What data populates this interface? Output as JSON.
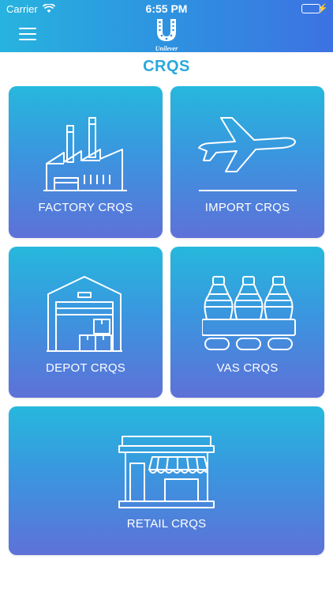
{
  "status_bar": {
    "carrier": "Carrier",
    "time": "6:55 PM"
  },
  "header": {
    "brand": "Unilever"
  },
  "page": {
    "title": "CRQS"
  },
  "tiles": [
    {
      "label": "FACTORY CRQS",
      "icon": "factory-icon"
    },
    {
      "label": "IMPORT CRQS",
      "icon": "airplane-icon"
    },
    {
      "label": "DEPOT CRQS",
      "icon": "warehouse-icon"
    },
    {
      "label": "VAS CRQS",
      "icon": "bottles-icon"
    },
    {
      "label": "RETAIL CRQS",
      "icon": "store-icon"
    }
  ],
  "colors": {
    "header_start": "#27b3df",
    "header_end": "#3d72e3",
    "tile_top": "#26b8dc",
    "tile_bottom": "#5e71d8",
    "title": "#2aa8dc"
  }
}
